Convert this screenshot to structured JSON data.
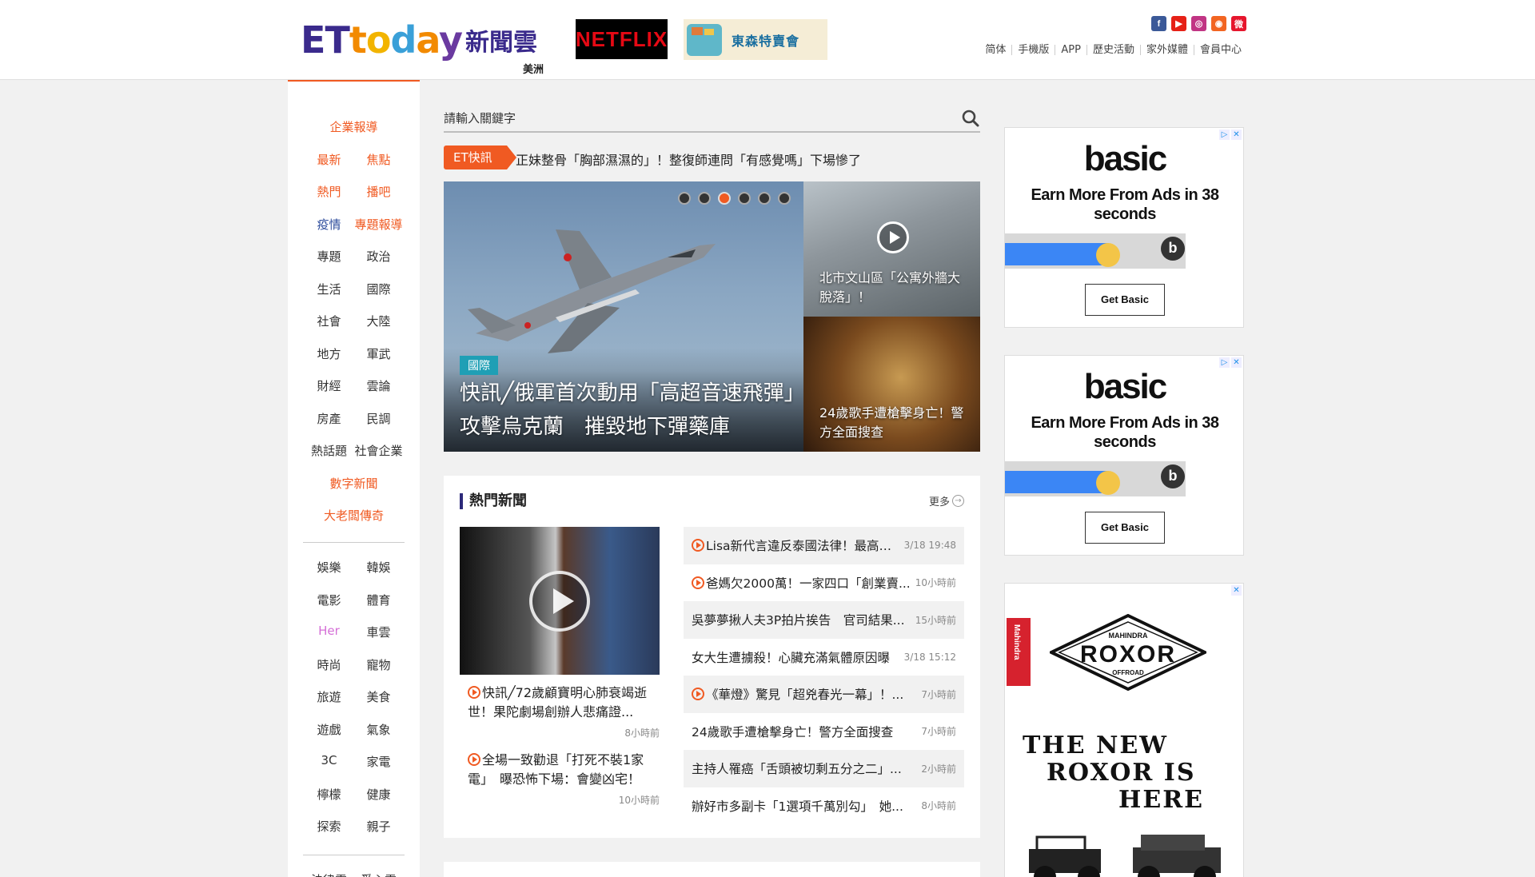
{
  "header": {
    "logo_et": [
      "E",
      "T",
      "t",
      "o",
      "d",
      "a",
      "y"
    ],
    "logo_zh": "新聞雲",
    "region": "美洲",
    "netflix_label": "NETFLIX",
    "tokyu_label": "東森特賣會",
    "social": [
      {
        "name": "facebook",
        "glyph": "f",
        "color": "#3b5998"
      },
      {
        "name": "youtube",
        "glyph": "▶",
        "color": "#e62117"
      },
      {
        "name": "instagram",
        "glyph": "◎",
        "color": "#c13584"
      },
      {
        "name": "rss",
        "glyph": "◉",
        "color": "#f26522"
      },
      {
        "name": "weibo",
        "glyph": "微",
        "color": "#e6162d"
      }
    ],
    "topnav": [
      "简体",
      "手機版",
      "APP",
      "歷史活動",
      "家外媒體",
      "會員中心"
    ]
  },
  "leftnav": {
    "group1": [
      {
        "items": [
          {
            "label": "企業報導",
            "color": "orange"
          }
        ]
      },
      {
        "items": [
          {
            "label": "最新",
            "color": "orange"
          },
          {
            "label": "焦點",
            "color": "orange"
          }
        ]
      },
      {
        "items": [
          {
            "label": "熱門",
            "color": "orange"
          },
          {
            "label": "播吧",
            "color": "orange"
          }
        ]
      },
      {
        "items": [
          {
            "label": "疫情",
            "color": "blue"
          },
          {
            "label": "專題報導",
            "color": "orange"
          }
        ]
      },
      {
        "items": [
          {
            "label": "專題",
            "color": ""
          },
          {
            "label": "政治",
            "color": ""
          }
        ]
      },
      {
        "items": [
          {
            "label": "生活",
            "color": ""
          },
          {
            "label": "國際",
            "color": ""
          }
        ]
      },
      {
        "items": [
          {
            "label": "社會",
            "color": ""
          },
          {
            "label": "大陸",
            "color": ""
          }
        ]
      },
      {
        "items": [
          {
            "label": "地方",
            "color": ""
          },
          {
            "label": "軍武",
            "color": ""
          }
        ]
      },
      {
        "items": [
          {
            "label": "財經",
            "color": ""
          },
          {
            "label": "雲論",
            "color": ""
          }
        ]
      },
      {
        "items": [
          {
            "label": "房產",
            "color": ""
          },
          {
            "label": "民調",
            "color": ""
          }
        ]
      },
      {
        "items": [
          {
            "label": "熱話題",
            "color": ""
          },
          {
            "label": "社會企業",
            "color": ""
          }
        ]
      },
      {
        "items": [
          {
            "label": "數字新聞",
            "color": "orange"
          }
        ]
      },
      {
        "items": [
          {
            "label": "大老闆傳奇",
            "color": "orange"
          }
        ]
      }
    ],
    "group2": [
      {
        "items": [
          {
            "label": "娛樂",
            "color": ""
          },
          {
            "label": "韓娛",
            "color": ""
          }
        ]
      },
      {
        "items": [
          {
            "label": "電影",
            "color": ""
          },
          {
            "label": "體育",
            "color": ""
          }
        ]
      },
      {
        "items": [
          {
            "label": "Her",
            "color": "pink"
          },
          {
            "label": "車雲",
            "color": ""
          }
        ]
      },
      {
        "items": [
          {
            "label": "時尚",
            "color": ""
          },
          {
            "label": "寵物",
            "color": ""
          }
        ]
      },
      {
        "items": [
          {
            "label": "旅遊",
            "color": ""
          },
          {
            "label": "美食",
            "color": ""
          }
        ]
      },
      {
        "items": [
          {
            "label": "遊戲",
            "color": ""
          },
          {
            "label": "氣象",
            "color": ""
          }
        ]
      },
      {
        "items": [
          {
            "label": "3C",
            "color": ""
          },
          {
            "label": "家電",
            "color": ""
          }
        ]
      },
      {
        "items": [
          {
            "label": "檸檬",
            "color": ""
          },
          {
            "label": "健康",
            "color": ""
          }
        ]
      },
      {
        "items": [
          {
            "label": "探索",
            "color": ""
          },
          {
            "label": "親子",
            "color": ""
          }
        ]
      }
    ],
    "group3": [
      {
        "items": [
          {
            "label": "法律雲",
            "color": ""
          },
          {
            "label": "愛心雲",
            "color": ""
          }
        ]
      }
    ]
  },
  "search": {
    "placeholder": "請輸入關鍵字"
  },
  "flash": {
    "badge": "ET快訊",
    "text": "正妹整骨「胸部濕濕的」！整復師連問「有感覺嗎」下場慘了"
  },
  "slider": {
    "category": "國際",
    "title": "快訊╱俄軍首次動用「高超音速飛彈」攻擊烏克蘭　摧毀地下彈藥庫",
    "dot_count": 6,
    "active_dot": 2
  },
  "side_stories": [
    {
      "title": "北市文山區「公寓外牆大脫落」！",
      "video": true
    },
    {
      "title": "24歲歌手遭槍擊身亡！警方全面搜查",
      "video": false
    }
  ],
  "hot": {
    "title": "熱門新聞",
    "more": "更多",
    "featured": [
      {
        "title": "快訊╱72歲顧寶明心肺衰竭逝世！果陀劇場創辦人悲痛證...",
        "time": "8小時前",
        "video": true
      },
      {
        "title": "全場一致勸退「打死不裝1家電」　曝恐怖下場：會變凶宅！",
        "time": "10小時前",
        "video": true
      }
    ],
    "list": [
      {
        "title": "Lisa新代言違反泰國法律！最高「...",
        "time": "3/18 19:48",
        "video": true
      },
      {
        "title": "爸媽欠2000萬！一家四口「創業賣...",
        "time": "10小時前",
        "video": true
      },
      {
        "title": "吳夢夢揪人夫3P拍片挨告　官司結果...",
        "time": "15小時前",
        "video": false
      },
      {
        "title": "女大生遭擄殺！心臟充滿氣體原因曝",
        "time": "3/18 15:12",
        "video": false
      },
      {
        "title": "《華燈》驚見「超兇春光一幕」！...",
        "time": "7小時前",
        "video": true
      },
      {
        "title": "24歲歌手遭槍擊身亡！警方全面搜查",
        "time": "7小時前",
        "video": false
      },
      {
        "title": "主持人罹癌「舌頭被切剩五分之二」...",
        "time": "2小時前",
        "video": false
      },
      {
        "title": "辦好市多副卡「1選項千萬別勾」　她...",
        "time": "8小時前",
        "video": false
      }
    ]
  },
  "ads": {
    "basic": {
      "logo": "basic",
      "tagline": "Earn More From Ads in 38 seconds",
      "button": "Get Basic",
      "badge": "b",
      "progress": 0.58
    },
    "roxor": {
      "brand": "Mahindra",
      "badge_top": "MAHINDRA",
      "badge_main": "ROXOR",
      "badge_bottom": "OFFROAD",
      "headline": [
        "THE NEW",
        "ROXOR IS",
        "HERE"
      ]
    }
  }
}
